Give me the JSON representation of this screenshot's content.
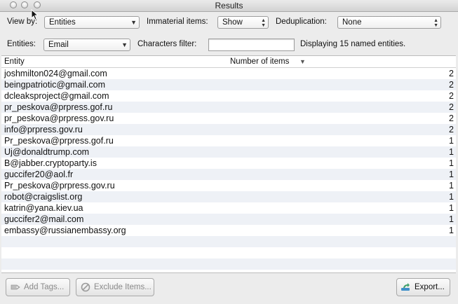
{
  "window": {
    "title": "Results"
  },
  "controls": {
    "view_by_label": "View by:",
    "view_by_value": "Entities",
    "immaterial_label": "Immaterial items:",
    "immaterial_value": "Show",
    "dedup_label": "Deduplication:",
    "dedup_value": "None",
    "entities_label": "Entities:",
    "entities_value": "Email",
    "filter_label": "Characters filter:",
    "filter_value": "",
    "display_info": "Displaying 15 named entities."
  },
  "table": {
    "columns": [
      "Entity",
      "Number of items"
    ],
    "sort_column": "Number of items",
    "sort_direction": "descending",
    "rows": [
      {
        "entity": "joshmilton024@gmail.com",
        "count": "2"
      },
      {
        "entity": "beingpatriotic@gmail.com",
        "count": "2"
      },
      {
        "entity": "dcleaksproject@gmail.com",
        "count": "2"
      },
      {
        "entity": "pr_peskova@prpress.gof.ru",
        "count": "2"
      },
      {
        "entity": "pr_peskova@prpress.gov.ru",
        "count": "2"
      },
      {
        "entity": "info@prpress.gov.ru",
        "count": "2"
      },
      {
        "entity": "Pr_peskova@prpress.gof.ru",
        "count": "1"
      },
      {
        "entity": "Uj@donaldtrump.com",
        "count": "1"
      },
      {
        "entity": "B@jabber.cryptoparty.is",
        "count": "1"
      },
      {
        "entity": "guccifer20@aol.fr",
        "count": "1"
      },
      {
        "entity": "Pr_peskova@prpress.gov.ru",
        "count": "1"
      },
      {
        "entity": "robot@craigslist.org",
        "count": "1"
      },
      {
        "entity": "katrin@yana.kiev.ua",
        "count": "1"
      },
      {
        "entity": "guccifer2@mail.com",
        "count": "1"
      },
      {
        "entity": "embassy@russianembassy.org",
        "count": "1"
      }
    ],
    "empty_rows": 4
  },
  "buttons": {
    "add_tags": "Add Tags...",
    "exclude_items": "Exclude Items...",
    "export": "Export..."
  },
  "icons": {
    "add_tags": "tag-icon",
    "exclude_items": "prohibit-icon",
    "export": "export-icon"
  }
}
